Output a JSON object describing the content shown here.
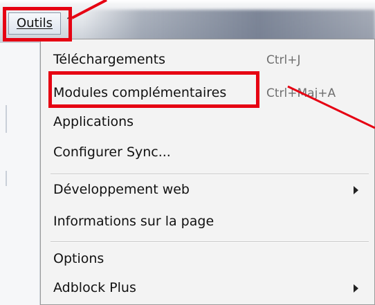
{
  "menubar": {
    "outils_label": "Outils",
    "next_label": "?"
  },
  "menu": {
    "items": [
      {
        "label": "Téléchargements",
        "shortcut": "Ctrl+J"
      },
      {
        "label": "Modules complémentaires",
        "shortcut": "Ctrl+Maj+A"
      },
      {
        "label": "Applications",
        "shortcut": ""
      },
      {
        "label": "Configurer Sync...",
        "shortcut": ""
      },
      {
        "label": "Développement web",
        "shortcut": ""
      },
      {
        "label": "Informations sur la page",
        "shortcut": ""
      },
      {
        "label": "Options",
        "shortcut": ""
      },
      {
        "label": "Adblock Plus",
        "shortcut": ""
      }
    ]
  },
  "annotations": {
    "color": "#e60012"
  }
}
